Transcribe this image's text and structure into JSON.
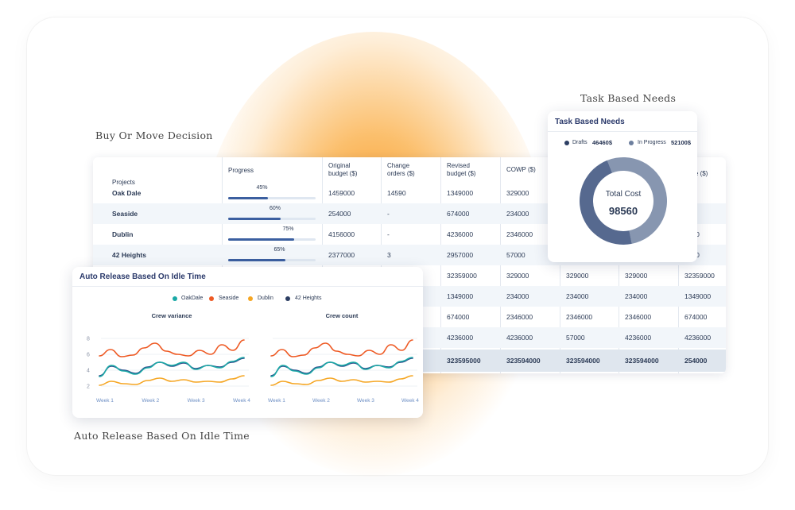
{
  "captions": {
    "buy_or_move": "Buy Or Move Decision",
    "task_based": "Task Based Needs",
    "auto_release": "Auto Release Based On Idle Time"
  },
  "table": {
    "headers": {
      "projects": "Projects",
      "progress": "Progress",
      "original_1": "Original",
      "original_2": "budget ($)",
      "change_1": "Change",
      "change_2": "orders ($)",
      "revised_1": "Revised",
      "revised_2": "budget ($)",
      "cowp": "COWP ($)",
      "budget_1": "get",
      "budget_2": "ance ($)"
    },
    "rows": [
      {
        "project": "Oak Dale",
        "progress": 45,
        "progress_label": "45%",
        "original": "1459000",
        "change": "14590",
        "revised": "1349000",
        "cowp": "329000",
        "c6": "",
        "c7": "",
        "c8": "000"
      },
      {
        "project": "Seaside",
        "progress": 60,
        "progress_label": "60%",
        "original": "254000",
        "change": "-",
        "revised": "674000",
        "cowp": "234000",
        "c6": "",
        "c7": "",
        "c8": "000"
      },
      {
        "project": "Dublin",
        "progress": 75,
        "progress_label": "75%",
        "original": "4156000",
        "change": "-",
        "revised": "4236000",
        "cowp": "2346000",
        "c6": "",
        "c7": "",
        "c8": "6000"
      },
      {
        "project": "42 Heights",
        "progress": 65,
        "progress_label": "65%",
        "original": "2377000",
        "change": "3",
        "revised": "2957000",
        "cowp": "57000",
        "c6": "",
        "c7": "",
        "c8": "7000"
      },
      {
        "project": "",
        "progress_label": "",
        "original": "",
        "change": "",
        "revised": "32359000",
        "cowp": "329000",
        "c6": "329000",
        "c7": "329000",
        "c8": "32359000"
      },
      {
        "project": "",
        "progress_label": "",
        "original": "",
        "change": "",
        "revised": "1349000",
        "cowp": "234000",
        "c6": "234000",
        "c7": "234000",
        "c8": "1349000"
      },
      {
        "project": "",
        "progress_label": "",
        "original": "",
        "change": "",
        "revised": "674000",
        "cowp": "2346000",
        "c6": "2346000",
        "c7": "2346000",
        "c8": "674000"
      },
      {
        "project": "",
        "progress_label": "",
        "original": "",
        "change": "",
        "revised": "4236000",
        "cowp": "4236000",
        "c6": "57000",
        "c7": "4236000",
        "c8": "4236000"
      }
    ],
    "total": {
      "revised": "323595000",
      "cowp": "323594000",
      "c6": "323594000",
      "c7": "323594000",
      "c8": "254000"
    }
  },
  "donut_card": {
    "title": "Task Based Needs",
    "legend": [
      {
        "label": "Drafts",
        "value": "46460$",
        "color": "#2c3e63"
      },
      {
        "label": "In Progress",
        "value": "52100$",
        "color": "#6d7f9e"
      }
    ],
    "center_label": "Total Cost",
    "center_value": "98560",
    "colors": {
      "drafts": "#56698f",
      "in_progress": "#8796b0"
    }
  },
  "line_card": {
    "title": "Auto Release Based On Idle Time",
    "legend": [
      {
        "label": "OakDale",
        "color": "#1aa9a6"
      },
      {
        "label": "Seaside",
        "color": "#ee5a24"
      },
      {
        "label": "Dublin",
        "color": "#f5a623"
      },
      {
        "label": "42 Heights",
        "color": "#2c3e63"
      }
    ]
  },
  "chart_data": [
    {
      "type": "line",
      "title": "Crew variance",
      "x": [
        "Week 1",
        "Week 2",
        "Week 3",
        "Week 4"
      ],
      "yticks": [
        "8",
        "6",
        "4",
        "2"
      ],
      "ylim": [
        1,
        9
      ],
      "series": [
        {
          "name": "Seaside",
          "color": "#ee5a24",
          "values": [
            5.8,
            6.6,
            5.7,
            5.9,
            6.8,
            7.4,
            6.4,
            6.0,
            5.8,
            6.5,
            6.0,
            7.2,
            6.5,
            7.8
          ]
        },
        {
          "name": "42 Heights",
          "color": "#2c4a8a",
          "values": [
            3.3,
            4.5,
            4.0,
            3.6,
            4.4,
            5.0,
            4.5,
            4.9,
            4.2,
            4.6,
            4.4,
            5.0,
            5.5
          ]
        },
        {
          "name": "Dublin",
          "color": "#f5a623",
          "values": [
            2.1,
            2.6,
            2.3,
            2.2,
            2.7,
            3.0,
            2.6,
            2.8,
            2.5,
            2.6,
            2.5,
            2.9,
            3.3
          ]
        },
        {
          "name": "OakDale",
          "color": "#1aa9a6",
          "values": [
            3.2,
            4.6,
            3.9,
            3.5,
            4.3,
            5.0,
            4.6,
            5.0,
            4.1,
            4.6,
            4.3,
            5.1,
            5.6
          ]
        }
      ]
    },
    {
      "type": "line",
      "title": "Crew count",
      "x": [
        "Week 1",
        "Week 2",
        "Week 3",
        "Week 4"
      ],
      "yticks": [],
      "ylim": [
        1,
        9
      ],
      "series": [
        {
          "name": "Seaside",
          "color": "#ee5a24",
          "values": [
            5.8,
            6.6,
            5.7,
            5.9,
            6.8,
            7.4,
            6.4,
            6.0,
            5.8,
            6.5,
            6.0,
            7.2,
            6.5,
            7.8
          ]
        },
        {
          "name": "42 Heights",
          "color": "#2c4a8a",
          "values": [
            3.3,
            4.5,
            4.0,
            3.6,
            4.4,
            5.0,
            4.5,
            4.9,
            4.2,
            4.6,
            4.4,
            5.0,
            5.5
          ]
        },
        {
          "name": "Dublin",
          "color": "#f5a623",
          "values": [
            2.1,
            2.6,
            2.3,
            2.2,
            2.7,
            3.0,
            2.6,
            2.8,
            2.5,
            2.6,
            2.5,
            2.9,
            3.3
          ]
        },
        {
          "name": "OakDale",
          "color": "#1aa9a6",
          "values": [
            3.2,
            4.6,
            3.9,
            3.5,
            4.3,
            5.0,
            4.6,
            5.0,
            4.1,
            4.6,
            4.3,
            5.1,
            5.6
          ]
        }
      ]
    }
  ]
}
